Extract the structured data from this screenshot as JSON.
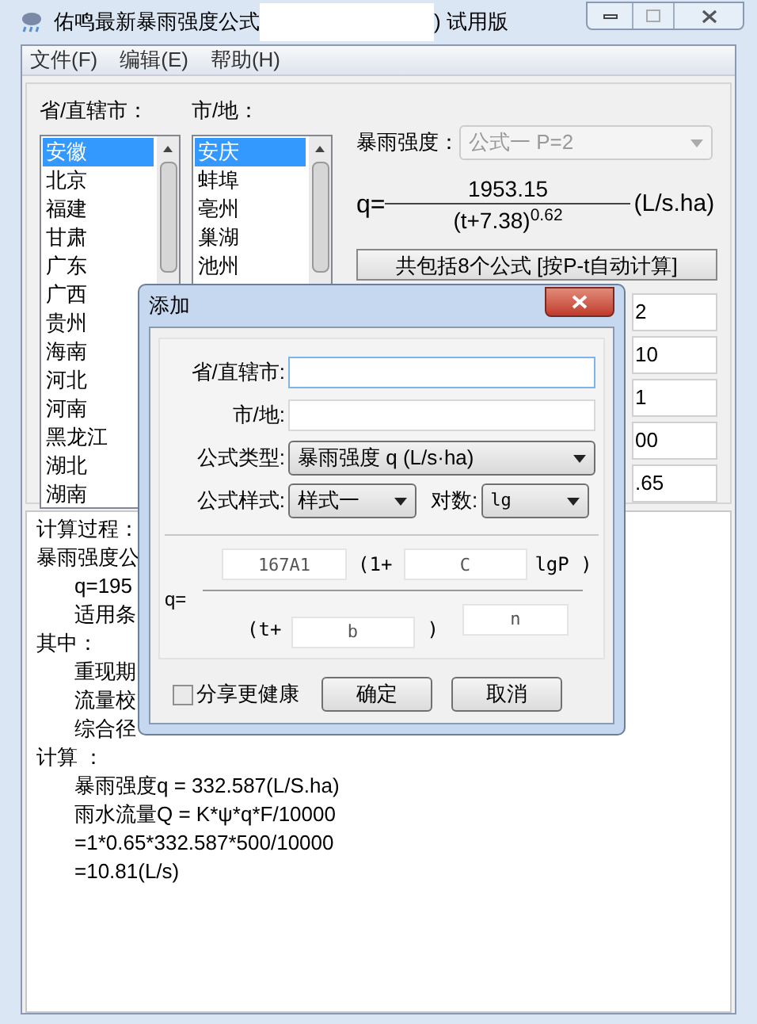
{
  "window": {
    "title_left": "佑鸣最新暴雨强度公式",
    "title_right": ") 试用版"
  },
  "menu": [
    "文件(F)",
    "编辑(E)",
    "帮助(H)"
  ],
  "provinces": {
    "label": "省/直辖市：",
    "items": [
      {
        "label": "安徽",
        "selected": true
      },
      {
        "label": "北京",
        "selected": false
      },
      {
        "label": "福建",
        "selected": false
      },
      {
        "label": "甘肃",
        "selected": false
      },
      {
        "label": "广东",
        "selected": false
      },
      {
        "label": "广西",
        "selected": false
      },
      {
        "label": "贵州",
        "selected": false
      },
      {
        "label": "海南",
        "selected": false
      },
      {
        "label": "河北",
        "selected": false
      },
      {
        "label": "河南",
        "selected": false
      },
      {
        "label": "黑龙江",
        "selected": false
      },
      {
        "label": "湖北",
        "selected": false
      },
      {
        "label": "湖南",
        "selected": false
      }
    ]
  },
  "cities": {
    "label": "市/地：",
    "items": [
      {
        "label": "安庆",
        "selected": true
      },
      {
        "label": "蚌埠",
        "selected": false
      },
      {
        "label": "亳州",
        "selected": false
      },
      {
        "label": "巢湖",
        "selected": false
      },
      {
        "label": "池州",
        "selected": false
      }
    ]
  },
  "formula_select": {
    "label": "暴雨强度：",
    "value": "公式一 P=2",
    "disabled": true
  },
  "formula": {
    "lhs": "q=",
    "numerator": "1953.15",
    "denominator": "(t+7.38)$^{0.62}$",
    "unit": "(L/s.ha)"
  },
  "auto_button": "共包括8个公式 [按P-t自动计算]",
  "params": [
    "2",
    "10",
    "1",
    "00",
    ".65"
  ],
  "process_lines": [
    {
      "text": "计算过程：",
      "kind": "heading"
    },
    {
      "text": "暴雨强度公",
      "kind": "heading"
    },
    {
      "text": "q=195",
      "kind": "line"
    },
    {
      "text": "适用条",
      "kind": "line"
    },
    {
      "text": "其中：",
      "kind": "heading"
    },
    {
      "text": "重现期",
      "kind": "line"
    },
    {
      "text": "流量校",
      "kind": "line"
    },
    {
      "text": "综合径",
      "kind": "line"
    },
    {
      "text": "计算 ：",
      "kind": "heading"
    },
    {
      "text": "暴雨强度q = 332.587(L/S.ha)",
      "kind": "line"
    },
    {
      "text": "雨水流量Q = K*ψ*q*F/10000",
      "kind": "line"
    },
    {
      "text": "=1*0.65*332.587*500/10000",
      "kind": "line"
    },
    {
      "text": "=10.81(L/s)",
      "kind": "line"
    }
  ],
  "dialog": {
    "title": "添加",
    "province_label": "省/直辖市:",
    "city_label": "市/地:",
    "formula_type": {
      "label": "公式类型:",
      "value": "暴雨强度 q (L/s·ha)"
    },
    "formula_style": {
      "label": "公式样式:",
      "value": "样式一"
    },
    "log": {
      "label": "对数:",
      "value": "lg"
    },
    "q_label": "q=",
    "a_field": {
      "placeholder": "167A1"
    },
    "open_text": "(1+",
    "c_field": {
      "placeholder": "C"
    },
    "lgp_text": "lgP )",
    "t_text": "(t+",
    "b_field": {
      "placeholder": "b"
    },
    "close_text": ")",
    "n_field": {
      "placeholder": "n"
    },
    "share": {
      "label": "分享更健康",
      "checked": false
    },
    "buttons": [
      "确定",
      "取消"
    ]
  }
}
